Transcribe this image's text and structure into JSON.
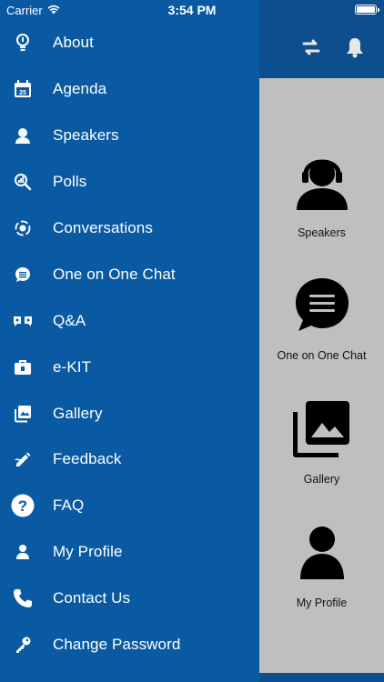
{
  "status_bar": {
    "carrier": "Carrier",
    "time": "3:54 PM"
  },
  "header": {
    "actions": [
      {
        "icon": "sync-icon"
      },
      {
        "icon": "bell-icon"
      }
    ]
  },
  "drawer": {
    "items": [
      {
        "label": "About",
        "icon": "info-bulb-icon"
      },
      {
        "label": "Agenda",
        "icon": "calendar-icon"
      },
      {
        "label": "Speakers",
        "icon": "speaker-headset-icon"
      },
      {
        "label": "Polls",
        "icon": "poll-icon"
      },
      {
        "label": "Conversations",
        "icon": "conversation-icon"
      },
      {
        "label": "One on One Chat",
        "icon": "chat-icon"
      },
      {
        "label": "Q&A",
        "icon": "qa-icon"
      },
      {
        "label": "e-KIT",
        "icon": "kit-icon"
      },
      {
        "label": "Gallery",
        "icon": "gallery-icon"
      },
      {
        "label": "Feedback",
        "icon": "feedback-icon"
      },
      {
        "label": "FAQ",
        "icon": "question-icon"
      },
      {
        "label": "My Profile",
        "icon": "profile-icon"
      },
      {
        "label": "Contact Us",
        "icon": "phone-icon"
      },
      {
        "label": "Change Password",
        "icon": "key-icon"
      }
    ]
  },
  "tiles": [
    {
      "label": "Speakers",
      "icon": "speaker-headset-icon"
    },
    {
      "label": "One on One Chat",
      "icon": "chat-icon"
    },
    {
      "label": "Gallery",
      "icon": "gallery-icon"
    },
    {
      "label": "My Profile",
      "icon": "profile-icon"
    }
  ],
  "colors": {
    "drawer": "#0a5aa3",
    "header": "#0d4e8f",
    "content": "#bfbfbf"
  }
}
